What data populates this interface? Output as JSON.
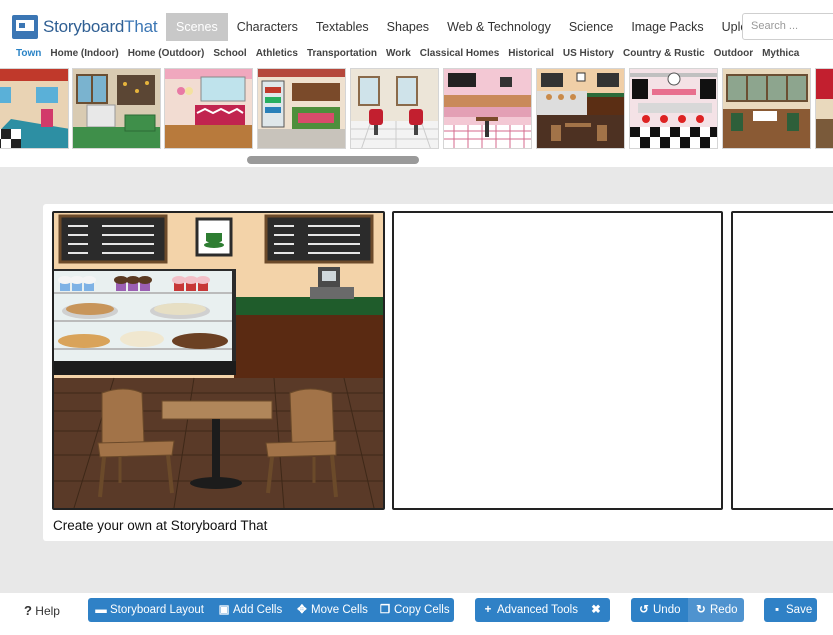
{
  "brand": {
    "name_a": "Storyboard",
    "name_b": "That"
  },
  "nav": [
    {
      "label": "Scenes",
      "active": true
    },
    {
      "label": "Characters",
      "active": false
    },
    {
      "label": "Textables",
      "active": false
    },
    {
      "label": "Shapes",
      "active": false
    },
    {
      "label": "Web & Technology",
      "active": false
    },
    {
      "label": "Science",
      "active": false
    },
    {
      "label": "Image Packs",
      "active": false
    },
    {
      "label": "Upload",
      "active": false
    }
  ],
  "search": {
    "placeholder": "Search ..."
  },
  "categories": [
    {
      "label": "Town",
      "active": true
    },
    {
      "label": "Home (Indoor)",
      "active": false
    },
    {
      "label": "Home (Outdoor)",
      "active": false
    },
    {
      "label": "School",
      "active": false
    },
    {
      "label": "Athletics",
      "active": false
    },
    {
      "label": "Transportation",
      "active": false
    },
    {
      "label": "Work",
      "active": false
    },
    {
      "label": "Classical Homes",
      "active": false
    },
    {
      "label": "Historical",
      "active": false
    },
    {
      "label": "US History",
      "active": false
    },
    {
      "label": "Country & Rustic",
      "active": false
    },
    {
      "label": "Outdoor",
      "active": false
    },
    {
      "label": "Mythica",
      "active": false
    }
  ],
  "board": {
    "credit": "Create your own at Storyboard That"
  },
  "toolbar": {
    "help": "Help",
    "help_icon": "?",
    "layout": "Storyboard Layout",
    "add_cells": "Add Cells",
    "move_cells": "Move Cells",
    "copy_cells": "Copy Cells",
    "advanced": "Advanced Tools",
    "undo": "Undo",
    "redo": "Redo",
    "save": "Save"
  },
  "colors": {
    "accent": "#2f81c6",
    "active_tab": "#c8c8c8",
    "workspace": "#e8e8e8",
    "category_active": "#2a83c6"
  }
}
